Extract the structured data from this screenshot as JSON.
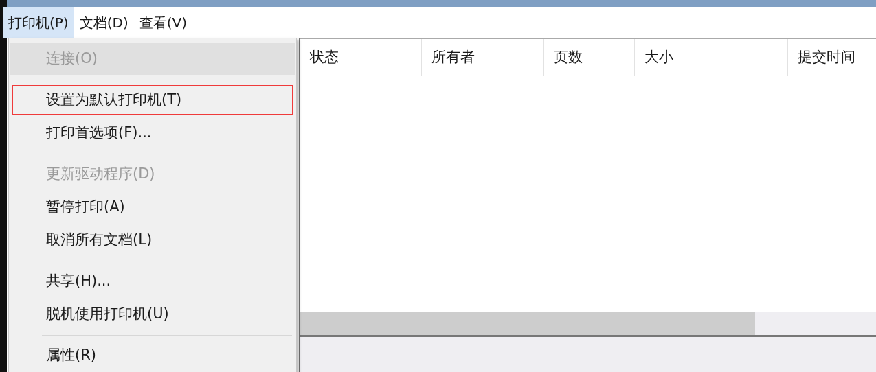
{
  "menubar": [
    {
      "label": "打印机(P)",
      "selected": true
    },
    {
      "label": "文档(D)",
      "selected": false
    },
    {
      "label": "查看(V)",
      "selected": false
    }
  ],
  "menu": [
    {
      "kind": "item",
      "label": "连接(O)",
      "disabled": true,
      "highlighted": true,
      "outlined": false
    },
    {
      "kind": "separator"
    },
    {
      "kind": "item",
      "label": "设置为默认打印机(T)",
      "disabled": false,
      "highlighted": false,
      "outlined": true
    },
    {
      "kind": "item",
      "label": "打印首选项(F)...",
      "disabled": false,
      "highlighted": false,
      "outlined": false
    },
    {
      "kind": "separator"
    },
    {
      "kind": "item",
      "label": "更新驱动程序(D)",
      "disabled": true,
      "highlighted": false,
      "outlined": false
    },
    {
      "kind": "item",
      "label": "暂停打印(A)",
      "disabled": false,
      "highlighted": false,
      "outlined": false
    },
    {
      "kind": "item",
      "label": "取消所有文档(L)",
      "disabled": false,
      "highlighted": false,
      "outlined": false
    },
    {
      "kind": "separator"
    },
    {
      "kind": "item",
      "label": "共享(H)...",
      "disabled": false,
      "highlighted": false,
      "outlined": false
    },
    {
      "kind": "item",
      "label": "脱机使用打印机(U)",
      "disabled": false,
      "highlighted": false,
      "outlined": false
    },
    {
      "kind": "separator"
    },
    {
      "kind": "item",
      "label": "属性(R)",
      "disabled": false,
      "highlighted": false,
      "outlined": false
    }
  ],
  "table": {
    "columns": [
      "状态",
      "所有者",
      "页数",
      "大小",
      "提交时间"
    ]
  }
}
